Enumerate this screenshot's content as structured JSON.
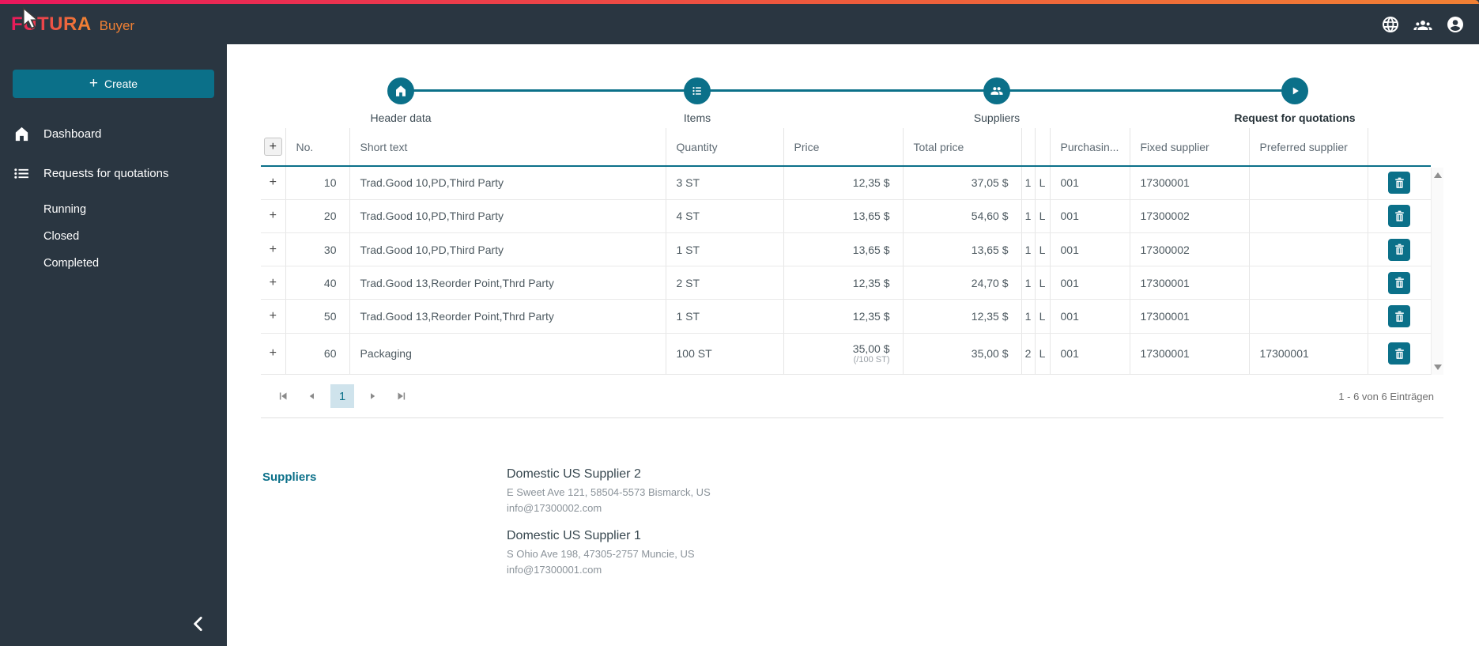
{
  "brand": {
    "name": "FUTURA",
    "suffix": "Buyer"
  },
  "topbar": {
    "icons": [
      {
        "name": "globe"
      },
      {
        "name": "users"
      },
      {
        "name": "account"
      }
    ]
  },
  "sidebar": {
    "create_plus": "+",
    "create_label": "Create",
    "items": [
      {
        "icon": "home",
        "label": "Dashboard"
      },
      {
        "icon": "list",
        "label": "Requests for quotations"
      }
    ],
    "subitems": [
      "Running",
      "Closed",
      "Completed"
    ]
  },
  "stepper": {
    "steps": [
      {
        "icon": "home",
        "label": "Header data"
      },
      {
        "icon": "list",
        "label": "Items"
      },
      {
        "icon": "people",
        "label": "Suppliers"
      },
      {
        "icon": "play",
        "label": "Request for quotations"
      }
    ]
  },
  "table": {
    "add_button_glyph": "+",
    "row_expander_glyph": "+",
    "columns": [
      {
        "label": ""
      },
      {
        "label": "No."
      },
      {
        "label": "Short text"
      },
      {
        "label": "Quantity"
      },
      {
        "label": "Price"
      },
      {
        "label": "Total price"
      },
      {
        "label": ""
      },
      {
        "label": ""
      },
      {
        "label": "Purchasin..."
      },
      {
        "label": "Fixed supplier"
      },
      {
        "label": "Preferred supplier"
      },
      {
        "label": ""
      }
    ],
    "rows": [
      {
        "no": "10",
        "short_text": "Trad.Good 10,PD,Third Party",
        "quantity": "3 ST",
        "price": "12,35 $",
        "price_unit": "",
        "total_price": "37,05 $",
        "col7": "1",
        "col8": "L",
        "purchasing": "001",
        "fixed_supplier": "17300001",
        "preferred_supplier": ""
      },
      {
        "no": "20",
        "short_text": "Trad.Good 10,PD,Third Party",
        "quantity": "4 ST",
        "price": "13,65 $",
        "price_unit": "",
        "total_price": "54,60 $",
        "col7": "1",
        "col8": "L",
        "purchasing": "001",
        "fixed_supplier": "17300002",
        "preferred_supplier": ""
      },
      {
        "no": "30",
        "short_text": "Trad.Good 10,PD,Third Party",
        "quantity": "1 ST",
        "price": "13,65 $",
        "price_unit": "",
        "total_price": "13,65 $",
        "col7": "1",
        "col8": "L",
        "purchasing": "001",
        "fixed_supplier": "17300002",
        "preferred_supplier": ""
      },
      {
        "no": "40",
        "short_text": "Trad.Good 13,Reorder Point,Thrd Party",
        "quantity": "2 ST",
        "price": "12,35 $",
        "price_unit": "",
        "total_price": "24,70 $",
        "col7": "1",
        "col8": "L",
        "purchasing": "001",
        "fixed_supplier": "17300001",
        "preferred_supplier": ""
      },
      {
        "no": "50",
        "short_text": "Trad.Good 13,Reorder Point,Thrd Party",
        "quantity": "1 ST",
        "price": "12,35 $",
        "price_unit": "",
        "total_price": "12,35 $",
        "col7": "1",
        "col8": "L",
        "purchasing": "001",
        "fixed_supplier": "17300001",
        "preferred_supplier": ""
      },
      {
        "no": "60",
        "short_text": "Packaging",
        "quantity": "100 ST",
        "price": "35,00 $",
        "price_unit": "(/100 ST)",
        "total_price": "35,00 $",
        "col7": "2",
        "col8": "L",
        "purchasing": "001",
        "fixed_supplier": "17300001",
        "preferred_supplier": "17300001"
      }
    ]
  },
  "pagination": {
    "current_page": "1",
    "summary": "1 - 6 von 6 Einträgen"
  },
  "suppliers": {
    "title": "Suppliers",
    "entries": [
      {
        "name": "Domestic US Supplier 2",
        "address": "E Sweet Ave 121, 58504-5573 Bismarck, US",
        "email": "info@17300002.com"
      },
      {
        "name": "Domestic US Supplier 1",
        "address": "S Ohio Ave 198, 47305-2757 Muncie, US",
        "email": "info@17300001.com"
      }
    ]
  },
  "colors": {
    "primary": "#0b7089",
    "topbar_bg": "#2a3641",
    "gradient_start": "#e9175c",
    "gradient_end": "#f08034",
    "active_page_bg": "#cfe3ec"
  }
}
